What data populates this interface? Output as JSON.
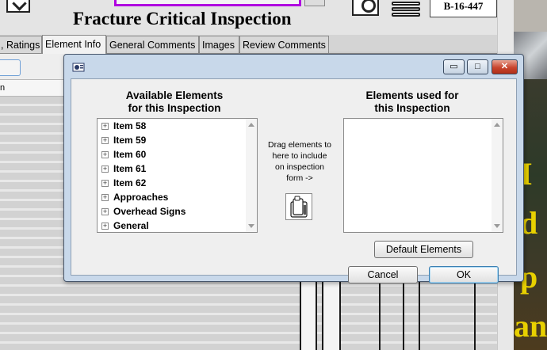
{
  "app": {
    "title": "Fracture Critical Inspection",
    "bridge_id": "B-16-447",
    "tabs": [
      {
        "label": ", Ratings"
      },
      {
        "label": "Element Info"
      },
      {
        "label": "General Comments"
      },
      {
        "label": "Images"
      },
      {
        "label": "Review Comments"
      }
    ],
    "column_header_fragment": "n"
  },
  "dialog": {
    "available": {
      "heading_line1": "Available Elements",
      "heading_line2": "for this Inspection",
      "items": [
        {
          "label": "Item 58"
        },
        {
          "label": "Item 59"
        },
        {
          "label": "Item 60"
        },
        {
          "label": "Item 61"
        },
        {
          "label": "Item 62"
        },
        {
          "label": "Approaches"
        },
        {
          "label": "Overhead Signs"
        },
        {
          "label": "General"
        }
      ]
    },
    "used": {
      "heading_line1": "Elements used for",
      "heading_line2": "this Inspection",
      "items": []
    },
    "drag_hint": [
      "Drag elements to",
      "here to include",
      "on inspection",
      "form ->"
    ],
    "buttons": {
      "default_elements": "Default Elements",
      "cancel": "Cancel",
      "ok": "OK"
    },
    "titlebar": {
      "minimize": "▭",
      "maximize": "□",
      "close": "✕"
    }
  },
  "photo_text": [
    "I",
    "d",
    "p",
    "an"
  ],
  "colors": {
    "dialog_frame": "#c8d8ea",
    "title_highlight": "#b000e0",
    "close_button": "#c8452e",
    "photo_text": "#e8d000"
  }
}
